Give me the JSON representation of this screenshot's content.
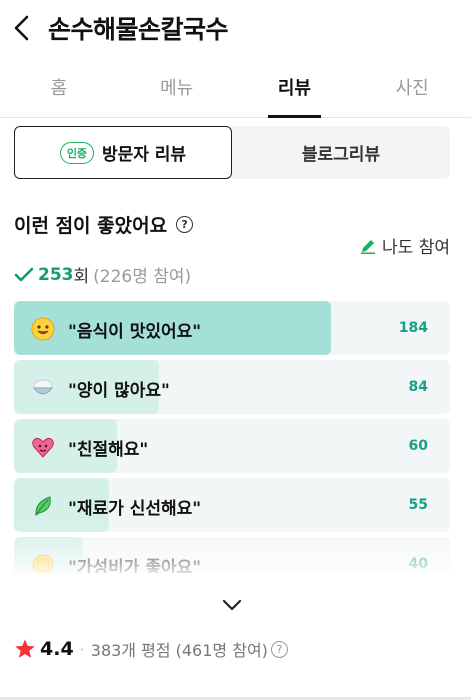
{
  "header": {
    "title": "손수해물손칼국수"
  },
  "tabs": [
    {
      "label": "홈",
      "active": false
    },
    {
      "label": "메뉴",
      "active": false
    },
    {
      "label": "리뷰",
      "active": true
    },
    {
      "label": "사진",
      "active": false
    }
  ],
  "review_type": {
    "visitor": {
      "badge": "인증",
      "label": "방문자 리뷰"
    },
    "blog": {
      "label": "블로그리뷰"
    }
  },
  "liked": {
    "title": "이런 점이 좋았어요",
    "help": "?",
    "me_too": "나도 참여",
    "count": "253",
    "count_unit": "회",
    "participants": "(226명 참여)"
  },
  "keyword_stats": [
    {
      "label": "\"음식이 맛있어요\"",
      "count": "184",
      "value": 184,
      "icon": "yum-face-icon"
    },
    {
      "label": "\"양이 많아요\"",
      "count": "84",
      "value": 84,
      "icon": "rice-bowl-icon"
    },
    {
      "label": "\"친절해요\"",
      "count": "60",
      "value": 60,
      "icon": "heart-face-icon"
    },
    {
      "label": "\"재료가 신선해요\"",
      "count": "55",
      "value": 55,
      "icon": "leaf-icon"
    },
    {
      "label": "\"가성비가 좋아요\"",
      "count": "40",
      "value": 40,
      "icon": "coin-icon"
    }
  ],
  "rating": {
    "value": "4.4",
    "dot": "·",
    "info": "383개 평점 (461명 참여)",
    "help": "?"
  },
  "colors": {
    "accent": "#0f9d74",
    "bar_top": "#a4e0d7",
    "bar_fill": "#d5efe9",
    "star": "#f0353a"
  }
}
